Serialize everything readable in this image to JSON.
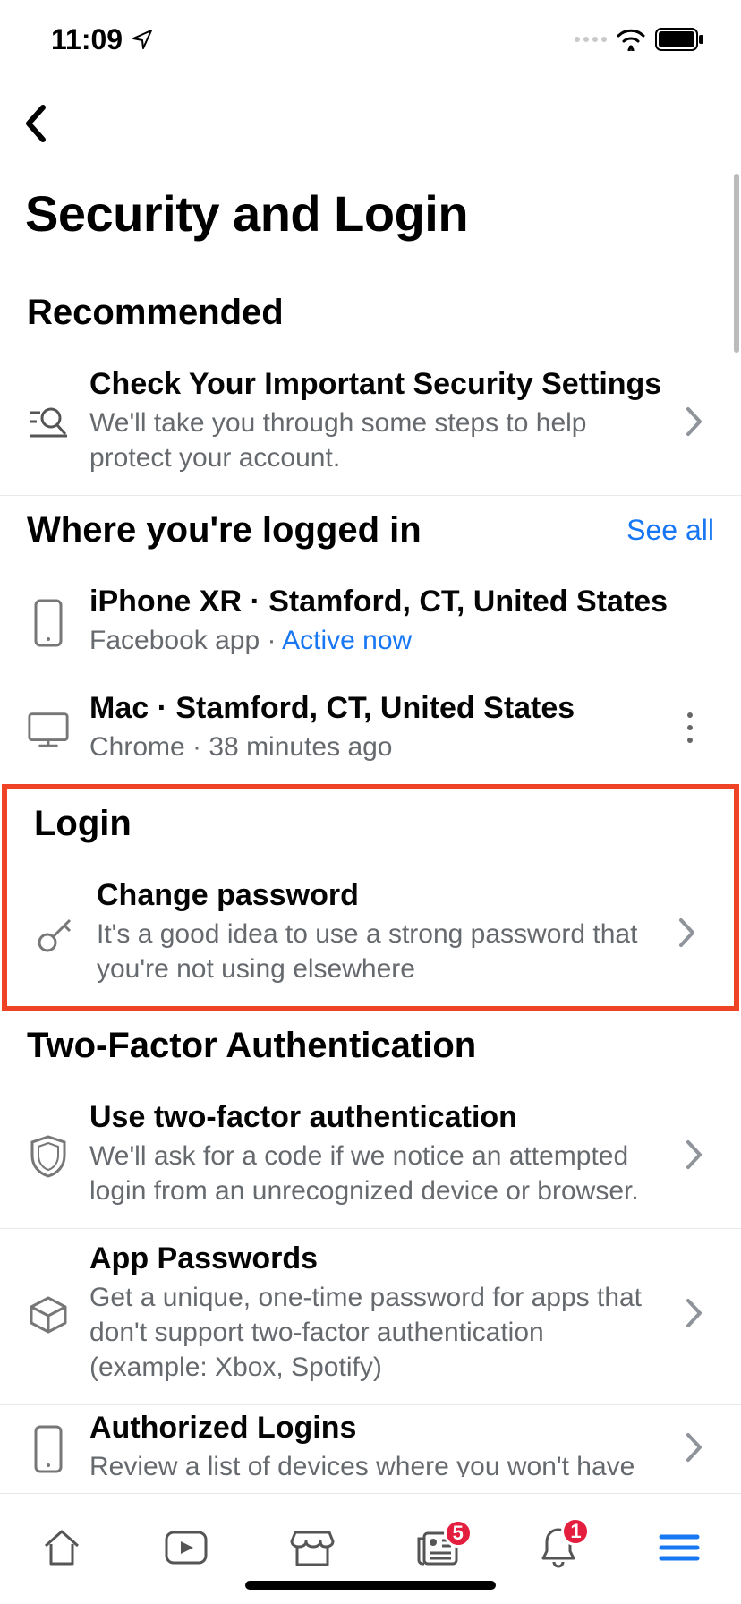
{
  "statusbar": {
    "time": "11:09"
  },
  "page_title": "Security and Login",
  "sections": {
    "recommended": {
      "header": "Recommended",
      "item": {
        "title": "Check Your Important Security Settings",
        "sub": "We'll take you through some steps to help protect your account."
      }
    },
    "where": {
      "header": "Where you're logged in",
      "see_all": "See all",
      "device1": {
        "title": "iPhone XR · Stamford, CT, United States",
        "app": "Facebook app",
        "dot": " · ",
        "status": "Active now"
      },
      "device2": {
        "title": "Mac · Stamford, CT, United States",
        "sub": "Chrome · 38 minutes ago"
      }
    },
    "login": {
      "header": "Login",
      "change": {
        "title": "Change password",
        "sub": "It's a good idea to use a strong password that you're not using elsewhere"
      }
    },
    "twofa": {
      "header": "Two-Factor Authentication",
      "use": {
        "title": "Use two-factor authentication",
        "sub": "We'll ask for a code if we notice an attempted login from an unrecognized device or browser."
      },
      "app_pw": {
        "title": "App Passwords",
        "sub": "Get a unique, one-time password for apps that don't support two-factor authentication (example: Xbox, Spotify)"
      },
      "auth_logins": {
        "title": "Authorized Logins",
        "sub": "Review a list of devices where you won't have"
      }
    }
  },
  "tabbar": {
    "news_badge": "5",
    "notif_badge": "1"
  }
}
